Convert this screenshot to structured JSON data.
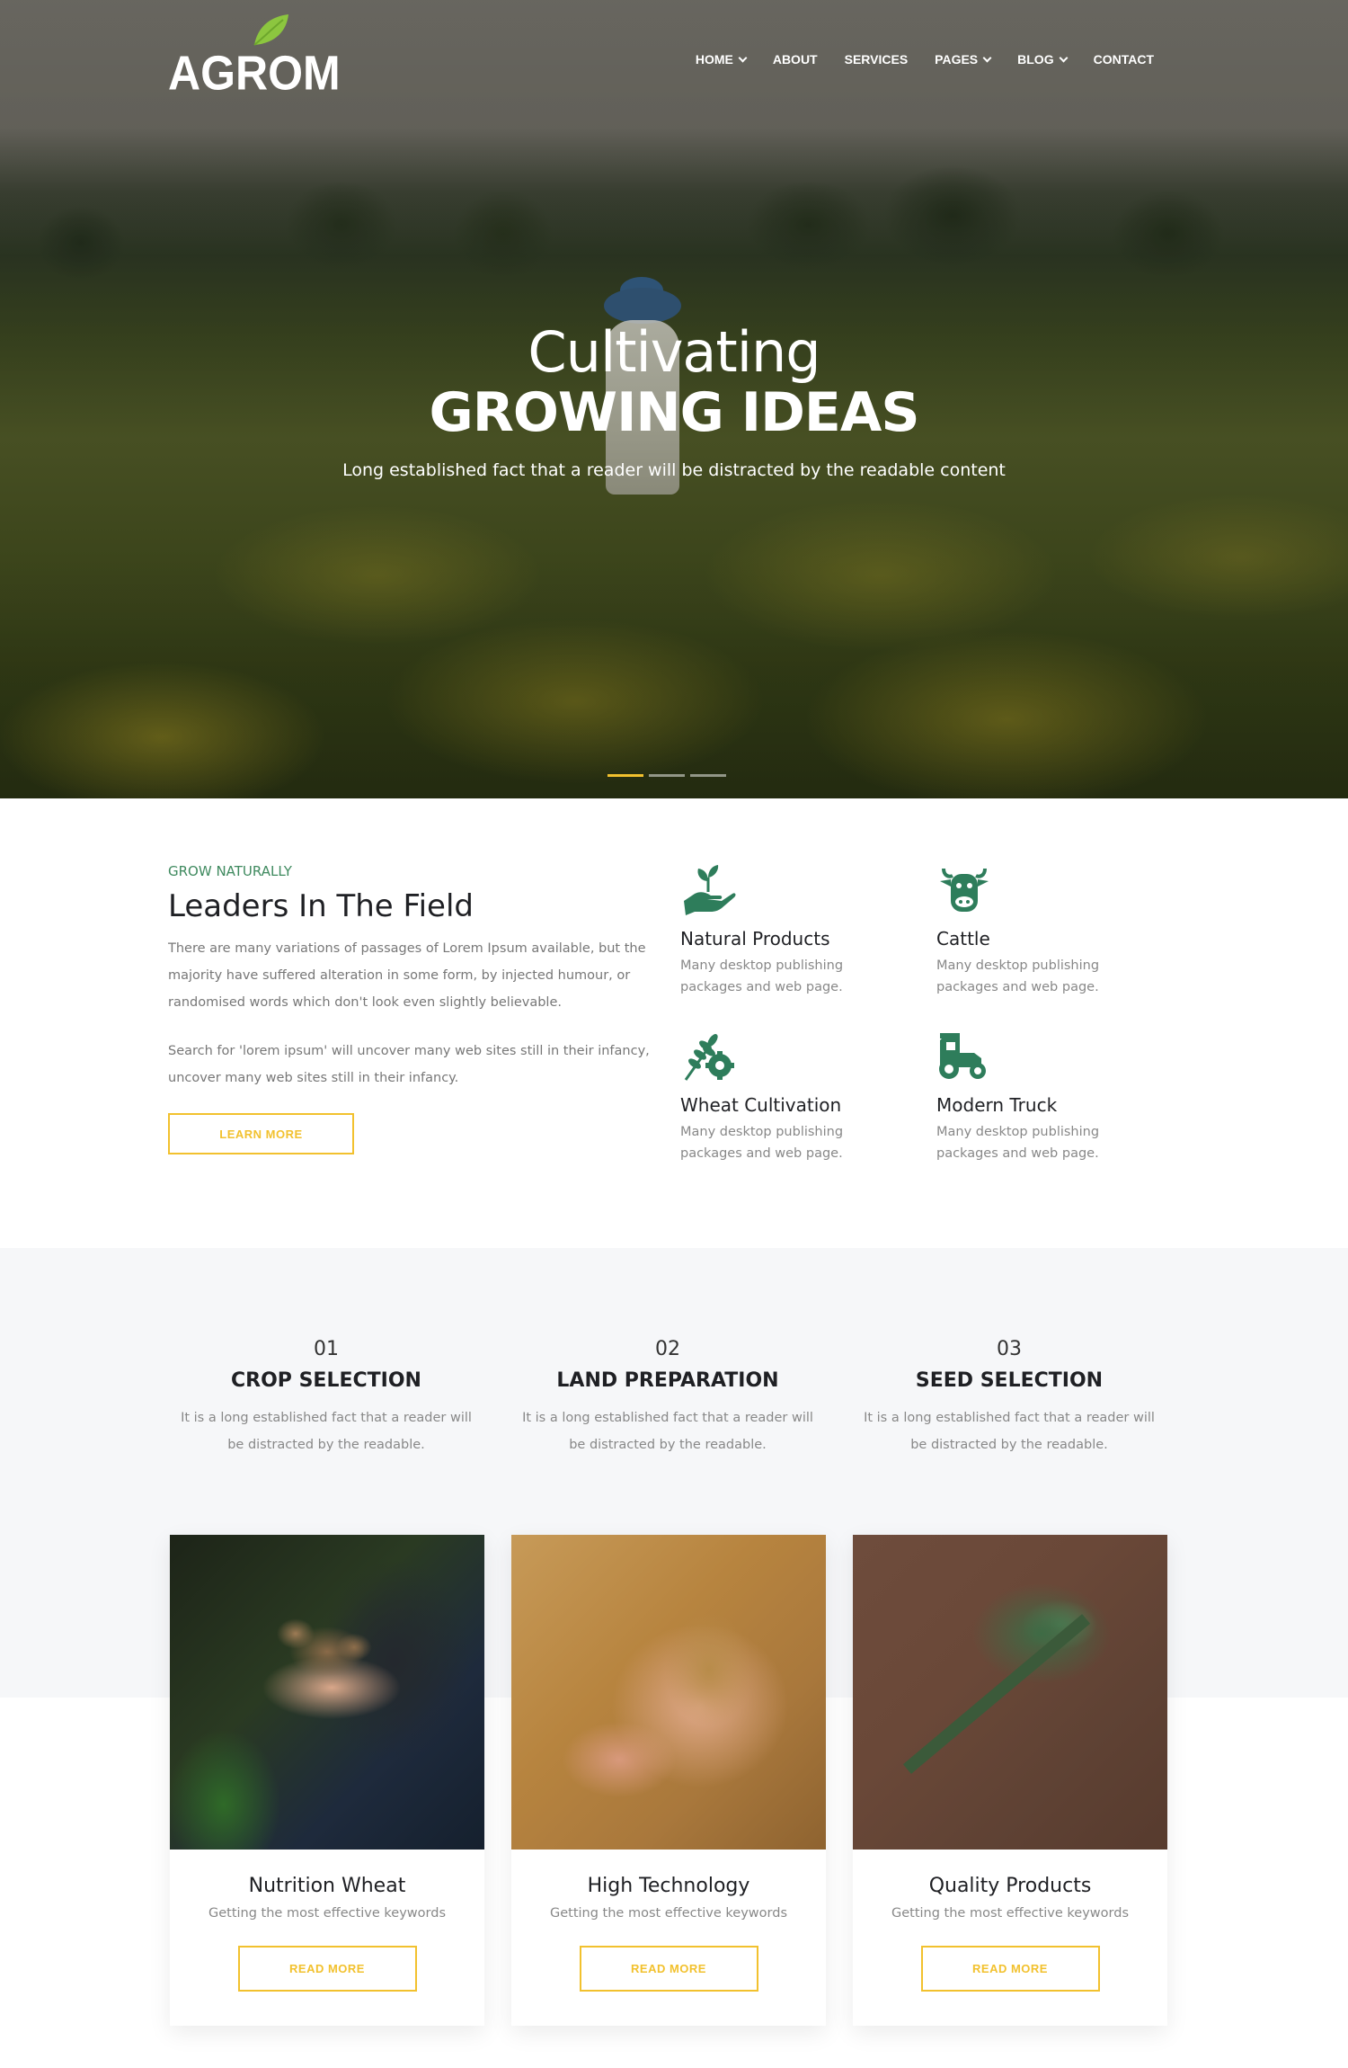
{
  "brand": {
    "logo_text": "AGROM",
    "leaf_color": "#8cc63f"
  },
  "nav": {
    "items": [
      {
        "label": "HOME",
        "has_dropdown": true
      },
      {
        "label": "ABOUT",
        "has_dropdown": false
      },
      {
        "label": "SERVICES",
        "has_dropdown": false
      },
      {
        "label": "PAGES",
        "has_dropdown": true
      },
      {
        "label": "BLOG",
        "has_dropdown": true
      },
      {
        "label": "CONTACT",
        "has_dropdown": false
      }
    ]
  },
  "hero": {
    "line1": "Cultivating",
    "title": "GROWING IDEAS",
    "description": "Long established fact that a reader will be distracted by the readable content",
    "slides": 3,
    "active_slide": 1
  },
  "about": {
    "eyebrow": "GROW NATURALLY",
    "title": "Leaders In The Field",
    "paragraph1": "There are many variations of passages of Lorem Ipsum available, but the majority have suffered alteration in some form, by injected humour, or randomised words which don't look even slightly believable.",
    "paragraph2": "Search for 'lorem ipsum' will uncover many web sites still in their infancy, uncover many web sites still in their infancy.",
    "button": "LEARN MORE",
    "features": [
      {
        "icon": "hand-plant-icon",
        "title": "Natural Products",
        "desc": "Many desktop publishing packages and web page."
      },
      {
        "icon": "cow-icon",
        "title": "Cattle",
        "desc": "Many desktop publishing packages and web page."
      },
      {
        "icon": "wheat-gear-icon",
        "title": "Wheat Cultivation",
        "desc": "Many desktop publishing packages and web page."
      },
      {
        "icon": "tractor-icon",
        "title": "Modern Truck",
        "desc": "Many desktop publishing packages and web page."
      }
    ]
  },
  "steps": [
    {
      "num": "01",
      "title": "CROP SELECTION",
      "desc": "It is a long established fact that a reader will be distracted by the readable."
    },
    {
      "num": "02",
      "title": "LAND PREPARATION",
      "desc": "It is a long established fact that a reader will be distracted by the readable."
    },
    {
      "num": "03",
      "title": "SEED SELECTION",
      "desc": "It is a long established fact that a reader will be distracted by the readable."
    }
  ],
  "cards": [
    {
      "title": "Nutrition Wheat",
      "desc": "Getting the most effective keywords",
      "button": "READ MORE"
    },
    {
      "title": "High Technology",
      "desc": "Getting the most effective keywords",
      "button": "READ MORE"
    },
    {
      "title": "Quality Products",
      "desc": "Getting the most effective keywords",
      "button": "READ MORE"
    }
  ],
  "colors": {
    "accent": "#f2c12e",
    "green": "#3f8a5f",
    "icon_green": "#2e7d5b"
  }
}
